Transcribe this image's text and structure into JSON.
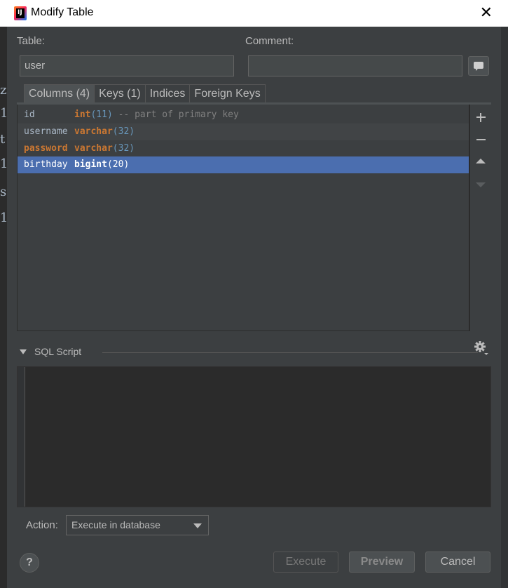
{
  "window": {
    "title": "Modify Table",
    "app_icon": "intellij-idea-icon",
    "close_glyph": "✕"
  },
  "background": {
    "gutter_chars": [
      "z",
      "1",
      "t",
      "1",
      "s",
      "1"
    ]
  },
  "table_field": {
    "label": "Table:",
    "value": "user"
  },
  "comment_field": {
    "label": "Comment:",
    "value": ""
  },
  "tabs": [
    {
      "label": "Columns (4)",
      "active": true
    },
    {
      "label": "Keys (1)",
      "active": false
    },
    {
      "label": "Indices",
      "active": false
    },
    {
      "label": "Foreign Keys",
      "active": false
    }
  ],
  "columns": [
    {
      "name": "id",
      "type": "int",
      "len": "(11)",
      "comment": " -- part of primary key"
    },
    {
      "name": "username",
      "type": "varchar",
      "len": "(32)",
      "comment": ""
    },
    {
      "name": "password",
      "type": "varchar",
      "len": "(32)",
      "comment": ""
    },
    {
      "name": "birthday",
      "type": "bigint",
      "len": "(20)",
      "comment": ""
    }
  ],
  "sql_section": {
    "title": "SQL Script",
    "content": ""
  },
  "action": {
    "label": "Action:",
    "selected": "Execute in database"
  },
  "buttons": {
    "help": "?",
    "execute": "Execute",
    "preview": "Preview",
    "cancel": "Cancel"
  },
  "colors": {
    "dialog_bg": "#3c3f41",
    "selection": "#4b6eaf",
    "keyword": "#cc7832",
    "number": "#6897bb",
    "comment": "#808080"
  }
}
